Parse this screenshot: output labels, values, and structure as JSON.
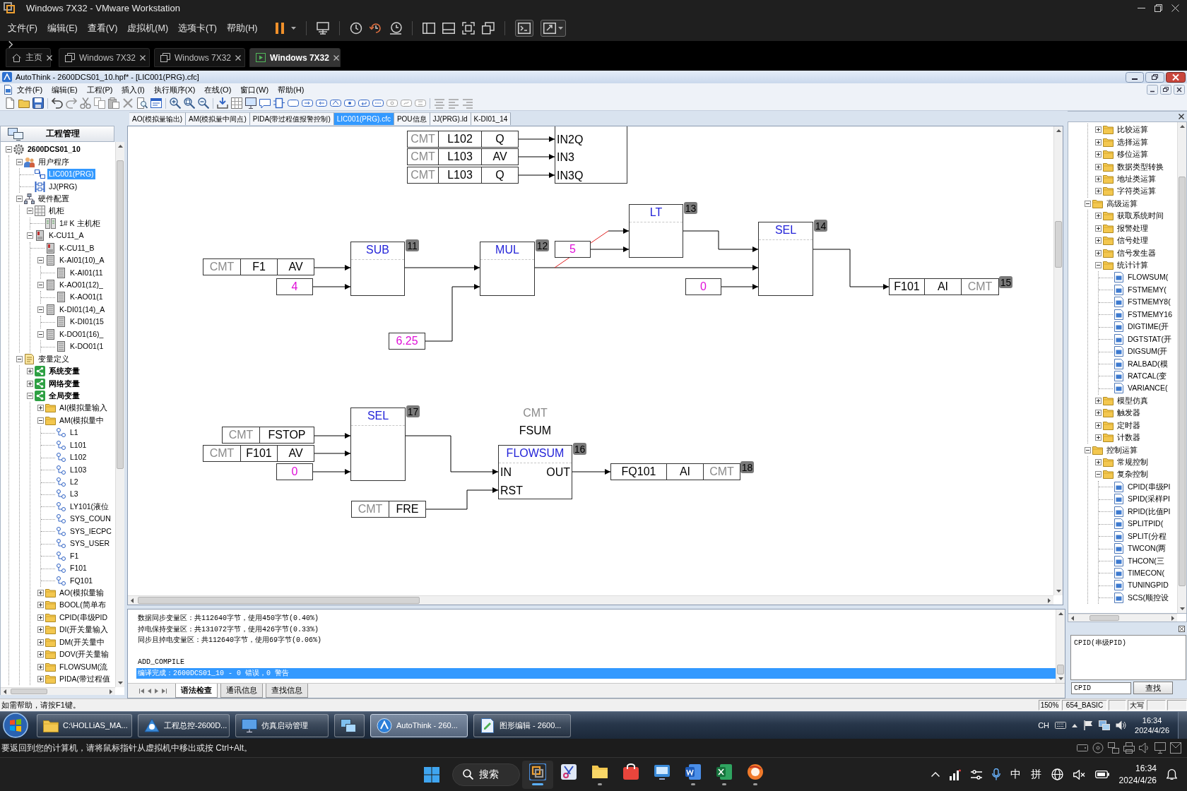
{
  "vmware": {
    "title": "Windows 7X32 - VMware Workstation",
    "menu": [
      "文件(F)",
      "编辑(E)",
      "查看(V)",
      "虚拟机(M)",
      "选项卡(T)",
      "帮助(H)"
    ],
    "tabs": [
      {
        "label": "主页",
        "kind": "home",
        "selected": false
      },
      {
        "label": "Windows 7X32",
        "kind": "vm",
        "selected": false
      },
      {
        "label": "Windows 7X32",
        "kind": "vm",
        "selected": false
      },
      {
        "label": "Windows 7X32",
        "kind": "vm",
        "selected": true
      }
    ],
    "hint": "要返回到您的计算机，请将鼠标指针从虚拟机中移出或按 Ctrl+Alt。"
  },
  "app": {
    "title": "AutoThink - 2600DCS01_10.hpf* - [LIC001(PRG).cfc]",
    "menu": [
      "文件(F)",
      "编辑(E)",
      "工程(P)",
      "插入(I)",
      "执行顺序(X)",
      "在线(O)",
      "窗口(W)",
      "帮助(H)"
    ],
    "doc_tabs": [
      {
        "label": "AO(模拟量输出)",
        "selected": false
      },
      {
        "label": "AM(模拟量中间点)",
        "selected": false
      },
      {
        "label": "PIDA(带过程值报警控制)",
        "selected": false
      },
      {
        "label": "LIC001(PRG).cfc",
        "selected": true
      },
      {
        "label": "POU信息",
        "selected": false
      },
      {
        "label": "JJ(PRG).ld",
        "selected": false
      },
      {
        "label": "K-DI01_14",
        "selected": false
      }
    ]
  },
  "project_tree": {
    "title": "工程管理",
    "items": [
      {
        "label": "2600DCS01_10",
        "kind": "project",
        "expanded": true,
        "selected": false,
        "children": [
          {
            "label": "用户程序",
            "kind": "programs",
            "expanded": true,
            "selected": false,
            "children": [
              {
                "label": "LIC001(PRG)",
                "kind": "cfc",
                "selected": true
              },
              {
                "label": "JJ(PRG)",
                "kind": "ld",
                "selected": false
              }
            ]
          },
          {
            "label": "硬件配置",
            "kind": "hardware",
            "expanded": true,
            "selected": false,
            "children": [
              {
                "label": "机柜",
                "kind": "cabinet",
                "expanded": true,
                "selected": false,
                "children": [
                  {
                    "label": "1# K 主机柜",
                    "kind": "rack",
                    "selected": false
                  }
                ]
              },
              {
                "label": "K-CU11_A",
                "kind": "controller",
                "expanded": true,
                "selected": false,
                "children": [
                  {
                    "label": "K-CU11_B",
                    "kind": "controller",
                    "selected": false
                  },
                  {
                    "label": "K-AI01(10)_A",
                    "kind": "module",
                    "expanded": true,
                    "selected": false,
                    "children": [
                      {
                        "label": "K-AI01(11",
                        "kind": "module",
                        "selected": false
                      }
                    ]
                  },
                  {
                    "label": "K-AO01(12)_",
                    "kind": "module",
                    "expanded": true,
                    "selected": false,
                    "children": [
                      {
                        "label": "K-AO01(1",
                        "kind": "module",
                        "selected": false
                      }
                    ]
                  },
                  {
                    "label": "K-DI01(14)_A",
                    "kind": "module",
                    "expanded": true,
                    "selected": false,
                    "children": [
                      {
                        "label": "K-DI01(15",
                        "kind": "module",
                        "selected": false
                      }
                    ]
                  },
                  {
                    "label": "K-DO01(16)_",
                    "kind": "module",
                    "expanded": true,
                    "selected": false,
                    "children": [
                      {
                        "label": "K-DO01(1",
                        "kind": "module",
                        "selected": false
                      }
                    ]
                  }
                ]
              }
            ]
          },
          {
            "label": "变量定义",
            "kind": "variables",
            "expanded": true,
            "selected": false,
            "children": [
              {
                "label": "系统变量",
                "kind": "var-group",
                "expanded": false,
                "selected": false
              },
              {
                "label": "网络变量",
                "kind": "var-group",
                "expanded": false,
                "selected": false
              },
              {
                "label": "全局变量",
                "kind": "var-group",
                "expanded": true,
                "selected": false,
                "children": [
                  {
                    "label": "AI(模拟量输入",
                    "kind": "folder",
                    "expanded": false,
                    "selected": false
                  },
                  {
                    "label": "AM(模拟量中",
                    "kind": "folder",
                    "expanded": true,
                    "selected": false,
                    "children": [
                      {
                        "label": "L1",
                        "kind": "variable",
                        "selected": false
                      },
                      {
                        "label": "L101",
                        "kind": "variable",
                        "selected": false
                      },
                      {
                        "label": "L102",
                        "kind": "variable",
                        "selected": false
                      },
                      {
                        "label": "L103",
                        "kind": "variable",
                        "selected": false
                      },
                      {
                        "label": "L2",
                        "kind": "variable",
                        "selected": false
                      },
                      {
                        "label": "L3",
                        "kind": "variable",
                        "selected": false
                      },
                      {
                        "label": "LY101(液位",
                        "kind": "variable",
                        "selected": false
                      },
                      {
                        "label": "SYS_COUN",
                        "kind": "variable",
                        "selected": false
                      },
                      {
                        "label": "SYS_IECPC",
                        "kind": "variable",
                        "selected": false
                      },
                      {
                        "label": "SYS_USER",
                        "kind": "variable",
                        "selected": false
                      },
                      {
                        "label": "F1",
                        "kind": "variable",
                        "selected": false
                      },
                      {
                        "label": "F101",
                        "kind": "variable",
                        "selected": false
                      },
                      {
                        "label": "FQ101",
                        "kind": "variable",
                        "selected": false
                      }
                    ]
                  },
                  {
                    "label": "AO(模拟量输",
                    "kind": "folder",
                    "expanded": false,
                    "selected": false
                  },
                  {
                    "label": "BOOL(简单布",
                    "kind": "folder",
                    "expanded": false,
                    "selected": false
                  },
                  {
                    "label": "CPID(串级PID",
                    "kind": "folder",
                    "expanded": false,
                    "selected": false
                  },
                  {
                    "label": "DI(开关量输入",
                    "kind": "folder",
                    "expanded": false,
                    "selected": false
                  },
                  {
                    "label": "DM(开关量中",
                    "kind": "folder",
                    "expanded": false,
                    "selected": false
                  },
                  {
                    "label": "DOV(开关量输",
                    "kind": "folder",
                    "expanded": false,
                    "selected": false
                  },
                  {
                    "label": "FLOWSUM(流",
                    "kind": "folder",
                    "expanded": false,
                    "selected": false
                  },
                  {
                    "label": "PIDA(带过程值",
                    "kind": "folder",
                    "expanded": false,
                    "selected": false
                  }
                ]
              }
            ]
          }
        ]
      }
    ]
  },
  "diagram": {
    "partial_block": {
      "pins": [
        "IN2Q",
        "IN3",
        "IN3Q"
      ]
    },
    "variables": [
      {
        "kind": "input",
        "comment": "CMT",
        "name": "L102",
        "field": "Q"
      },
      {
        "kind": "input",
        "comment": "CMT",
        "name": "L103",
        "field": "AV"
      },
      {
        "kind": "input",
        "comment": "CMT",
        "name": "L103",
        "field": "Q"
      },
      {
        "kind": "input",
        "comment": "CMT",
        "name": "F1",
        "field": "AV"
      },
      {
        "kind": "output",
        "name": "F101",
        "field": "AI",
        "comment": "CMT",
        "order": "15"
      },
      {
        "kind": "input",
        "comment": "CMT",
        "name": "FSTOP"
      },
      {
        "kind": "input",
        "comment": "CMT",
        "name": "F101",
        "field": "AV"
      },
      {
        "kind": "input",
        "comment": "CMT",
        "name": "FRE"
      },
      {
        "kind": "output",
        "name": "FQ101",
        "field": "AI",
        "comment": "CMT",
        "order": "18"
      }
    ],
    "constants": [
      "4",
      "6.25",
      "5",
      "0",
      "0"
    ],
    "blocks": [
      {
        "name": "SUB",
        "order": "11"
      },
      {
        "name": "MUL",
        "order": "12"
      },
      {
        "name": "LT",
        "order": "13"
      },
      {
        "name": "SEL",
        "order": "14"
      },
      {
        "name": "SEL",
        "order": "17"
      },
      {
        "name": "FLOWSUM",
        "order": "16",
        "comment": "CMT",
        "instance": "FSUM",
        "inputs": [
          "IN",
          "RST"
        ],
        "outputs": [
          "OUT"
        ]
      }
    ]
  },
  "output": {
    "memory_lines": [
      "数据同步变量区：共112640字节，使用450字节(0.40%)",
      "掉电保持变量区：共131072字节，使用426字节(0.33%)",
      "同步且掉电变量区：共112640字节，使用69字节(0.06%)"
    ],
    "compile_lines": [
      {
        "text": "ADD_COMPILE",
        "selected": false
      },
      {
        "text": "编译完成：2600DCS01_10 - 0 错误，0 警告",
        "selected": true
      }
    ],
    "tabs": [
      {
        "label": "语法检查",
        "selected": true
      },
      {
        "label": "通讯信息",
        "selected": false
      },
      {
        "label": "查找信息",
        "selected": false
      }
    ]
  },
  "library_tree": {
    "leading_children": [
      {
        "label": "比较运算",
        "kind": "folder",
        "expanded": false
      },
      {
        "label": "选择运算",
        "kind": "folder",
        "expanded": false
      },
      {
        "label": "移位运算",
        "kind": "folder",
        "expanded": false
      },
      {
        "label": "数据类型转换",
        "kind": "folder",
        "expanded": false
      },
      {
        "label": "地址类运算",
        "kind": "folder",
        "expanded": false
      },
      {
        "label": "字符类运算",
        "kind": "folder",
        "expanded": false
      }
    ],
    "items": [
      {
        "label": "高级运算",
        "kind": "folder",
        "expanded": true,
        "children": [
          {
            "label": "获取系统时间",
            "kind": "folder",
            "expanded": false
          },
          {
            "label": "报警处理",
            "kind": "folder",
            "expanded": false
          },
          {
            "label": "信号处理",
            "kind": "folder",
            "expanded": false
          },
          {
            "label": "信号发生器",
            "kind": "folder",
            "expanded": false
          },
          {
            "label": "统计计算",
            "kind": "folder",
            "expanded": true,
            "children": [
              {
                "label": "FLOWSUM(",
                "kind": "function"
              },
              {
                "label": "FSTMEMY(",
                "kind": "function"
              },
              {
                "label": "FSTMEMY8(",
                "kind": "function"
              },
              {
                "label": "FSTMEMY16",
                "kind": "function"
              },
              {
                "label": "DIGTIME(开",
                "kind": "function"
              },
              {
                "label": "DGTSTAT(开",
                "kind": "function"
              },
              {
                "label": "DIGSUM(开",
                "kind": "function"
              },
              {
                "label": "RALBAD(模",
                "kind": "function"
              },
              {
                "label": "RATCAL(变",
                "kind": "function"
              },
              {
                "label": "VARIANCE(",
                "kind": "function"
              }
            ]
          },
          {
            "label": "模型仿真",
            "kind": "folder",
            "expanded": false
          },
          {
            "label": "触发器",
            "kind": "folder",
            "expanded": false
          },
          {
            "label": "定时器",
            "kind": "folder",
            "expanded": false
          },
          {
            "label": "计数器",
            "kind": "folder",
            "expanded": false
          }
        ]
      },
      {
        "label": "控制运算",
        "kind": "folder",
        "expanded": true,
        "children": [
          {
            "label": "常规控制",
            "kind": "folder",
            "expanded": false
          },
          {
            "label": "复杂控制",
            "kind": "folder",
            "expanded": true,
            "children": [
              {
                "label": "CPID(串级PI",
                "kind": "function"
              },
              {
                "label": "SPID(采样PI",
                "kind": "function"
              },
              {
                "label": "RPID(比值PI",
                "kind": "function"
              },
              {
                "label": "SPLITPID(",
                "kind": "function"
              },
              {
                "label": "SPLIT(分程",
                "kind": "function"
              },
              {
                "label": "TWCON(两",
                "kind": "function"
              },
              {
                "label": "THCON(三",
                "kind": "function"
              },
              {
                "label": "TIMECON(",
                "kind": "function"
              },
              {
                "label": "TUNINGPID",
                "kind": "function"
              },
              {
                "label": "SCS(顺控设",
                "kind": "function"
              }
            ]
          }
        ]
      }
    ]
  },
  "library_info": {
    "description": "CPID(串级PID)",
    "search": {
      "value": "CPID"
    },
    "button": "查找"
  },
  "status_bar": {
    "message": "如需帮助，请按F1键。",
    "cells": [
      "150%",
      "654_BASIC",
      "大写"
    ]
  },
  "win7_taskbar": {
    "buttons": [
      {
        "label": "C:\\HOLLiAS_MA...",
        "selected": false
      },
      {
        "label": "工程总控-2600D...",
        "selected": false
      },
      {
        "label": "仿真启动管理",
        "selected": false
      },
      {
        "selected": false
      },
      {
        "label": "AutoThink - 260...",
        "selected": true
      },
      {
        "label": "图形编辑 - 2600...",
        "selected": false
      }
    ],
    "language": "CH",
    "time": "16:34",
    "date": "2024/4/26"
  },
  "win11_taskbar": {
    "search_label": "搜索",
    "apps": [
      {
        "running": true,
        "selected": true
      },
      {
        "running": false,
        "selected": false
      },
      {
        "running": true,
        "selected": false
      },
      {
        "running": false,
        "selected": false
      },
      {
        "running": false,
        "selected": false
      },
      {
        "running": true,
        "selected": false
      },
      {
        "running": true,
        "selected": false
      },
      {
        "running": true,
        "selected": false
      }
    ],
    "ime_mode": "中",
    "ime": "拼",
    "time": "16:34",
    "date": "2024/4/26"
  }
}
